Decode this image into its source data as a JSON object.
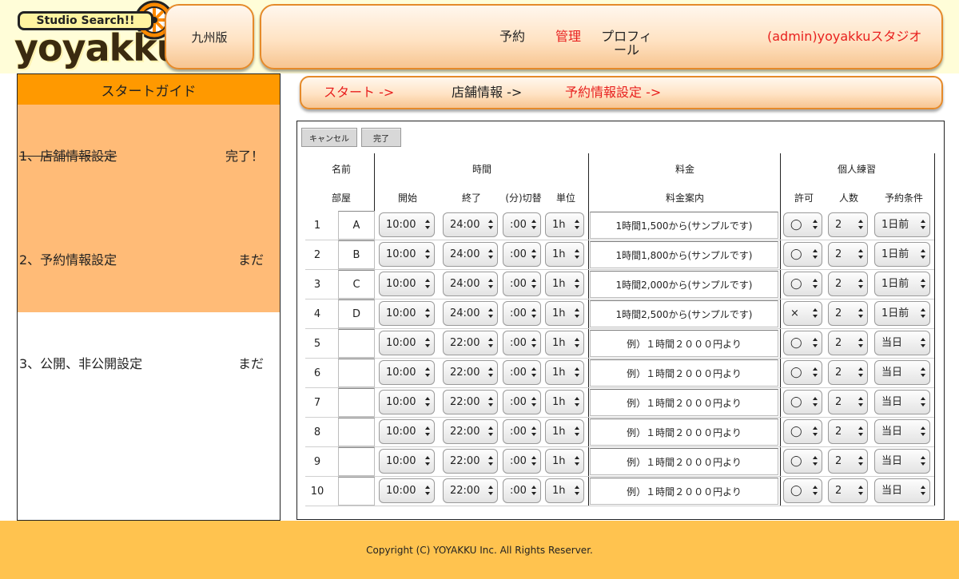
{
  "header": {
    "logo_sub": "Studio Search!!",
    "logo_main": "yoyakku",
    "region": "九州版",
    "nav": {
      "reserve": "予約",
      "manage": "管理",
      "profile_line1": "プロフィ",
      "profile_line2": "ール",
      "user": "(admin)yoyakkuスタジオ"
    }
  },
  "sidebar": {
    "title": "スタートガイド",
    "steps": [
      {
        "label": "1、店舗情報設定",
        "status": "完了！"
      },
      {
        "label": "2、予約情報設定",
        "status": "まだ"
      },
      {
        "label": "3、公開、非公開設定",
        "status": "まだ"
      }
    ]
  },
  "stepbar": {
    "start": "スタート ->",
    "shop": "店舗情報 ->",
    "reserve": "予約情報設定 ->"
  },
  "colors": {
    "accent": "#ff9900",
    "step_active": "#ffbb77",
    "footer": "#ffc34f",
    "red": "#e8201e"
  },
  "form": {
    "cancel": "キャンセル",
    "done": "完了",
    "headers": {
      "name": "名前",
      "time": "時間",
      "fee": "料金",
      "personal": "個人練習",
      "room": "部屋",
      "start": "開始",
      "end": "終了",
      "switch": "(分)切替",
      "unit": "単位",
      "fee_guide": "料金案内",
      "permit": "許可",
      "people": "人数",
      "condition": "予約条件"
    },
    "rows": [
      {
        "no": "1",
        "room": "A",
        "start": "10:00",
        "end": "24:00",
        "switch": ":00",
        "unit": "1h",
        "price": "1時間1,500から(サンプルです)",
        "permit": "◯",
        "people": "2",
        "condition": "1日前"
      },
      {
        "no": "2",
        "room": "B",
        "start": "10:00",
        "end": "24:00",
        "switch": ":00",
        "unit": "1h",
        "price": "1時間1,800から(サンプルです)",
        "permit": "◯",
        "people": "2",
        "condition": "1日前"
      },
      {
        "no": "3",
        "room": "C",
        "start": "10:00",
        "end": "24:00",
        "switch": ":00",
        "unit": "1h",
        "price": "1時間2,000から(サンプルです)",
        "permit": "◯",
        "people": "2",
        "condition": "1日前"
      },
      {
        "no": "4",
        "room": "D",
        "start": "10:00",
        "end": "24:00",
        "switch": ":00",
        "unit": "1h",
        "price": "1時間2,500から(サンプルです)",
        "permit": "×",
        "people": "2",
        "condition": "1日前"
      },
      {
        "no": "5",
        "room": "",
        "start": "10:00",
        "end": "22:00",
        "switch": ":00",
        "unit": "1h",
        "price": "例）１時間２０００円より",
        "permit": "◯",
        "people": "2",
        "condition": "当日"
      },
      {
        "no": "6",
        "room": "",
        "start": "10:00",
        "end": "22:00",
        "switch": ":00",
        "unit": "1h",
        "price": "例）１時間２０００円より",
        "permit": "◯",
        "people": "2",
        "condition": "当日"
      },
      {
        "no": "7",
        "room": "",
        "start": "10:00",
        "end": "22:00",
        "switch": ":00",
        "unit": "1h",
        "price": "例）１時間２０００円より",
        "permit": "◯",
        "people": "2",
        "condition": "当日"
      },
      {
        "no": "8",
        "room": "",
        "start": "10:00",
        "end": "22:00",
        "switch": ":00",
        "unit": "1h",
        "price": "例）１時間２０００円より",
        "permit": "◯",
        "people": "2",
        "condition": "当日"
      },
      {
        "no": "9",
        "room": "",
        "start": "10:00",
        "end": "22:00",
        "switch": ":00",
        "unit": "1h",
        "price": "例）１時間２０００円より",
        "permit": "◯",
        "people": "2",
        "condition": "当日"
      },
      {
        "no": "10",
        "room": "",
        "start": "10:00",
        "end": "22:00",
        "switch": ":00",
        "unit": "1h",
        "price": "例）１時間２０００円より",
        "permit": "◯",
        "people": "2",
        "condition": "当日"
      }
    ]
  },
  "footer": {
    "copyright": "Copyright (C) YOYAKKU Inc. All Rights Reserver."
  }
}
